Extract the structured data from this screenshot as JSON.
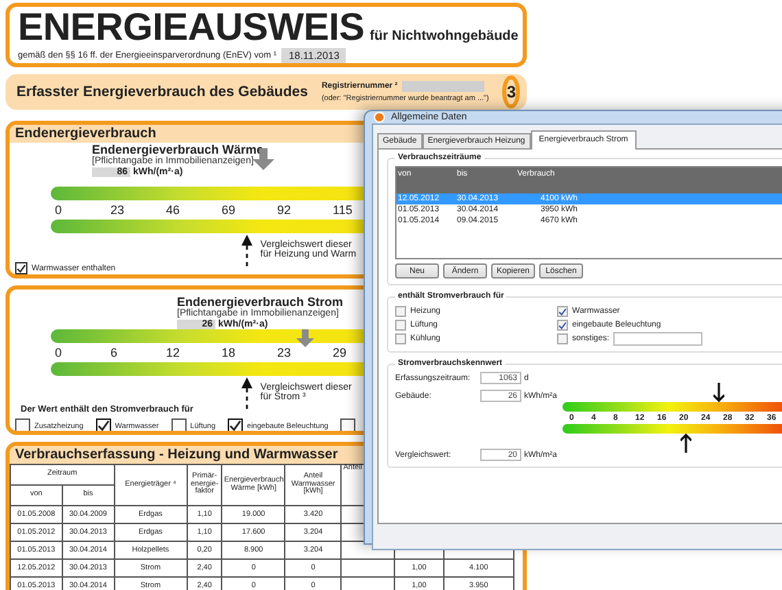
{
  "document": {
    "title": "ENERGIEAUSWEIS",
    "title_suffix": "für Nichtwohngebäude",
    "subtitle": "gemäß den §§ 16 ff. der Energieeinsparverordnung (EnEV) vom ¹",
    "date": "18.11.2013",
    "section_title": "Erfasster Energieverbrauch des Gebäudes",
    "registration_label": "Registriernummer ²",
    "registration_note": "(oder: \"Registriernummer wurde beantragt am ...\")",
    "page_badge": "3",
    "energy_heading": "Endenergieverbrauch",
    "scales": [
      {
        "title": "Endenergieverbrauch Wärme",
        "subtitle": "[Pflichtangabe in Immobilienanzeigen]",
        "value": "86",
        "unit": "kWh/(m²·a)",
        "ticks": [
          "0",
          "23",
          "46",
          "69",
          "92",
          "115"
        ],
        "value_marker": {
          "level": 0.455
        },
        "compare_marker": {
          "level": 0.42
        },
        "compare_lines": [
          "Vergleichswert dieser",
          "für Heizung und Warm"
        ]
      },
      {
        "title": "Endenergieverbrauch Strom",
        "subtitle": "[Pflichtangabe in Immobilienanzeigen]",
        "value": "26",
        "unit": "kWh/(m²·a)",
        "ticks": [
          "0",
          "6",
          "12",
          "18",
          "23",
          "29"
        ],
        "value_marker": {
          "level": 0.55
        },
        "compare_marker": {
          "level": 0.42
        },
        "compare_lines": [
          "Vergleichswert dieser",
          "für Strom ³"
        ]
      }
    ],
    "hot_water_check": {
      "label": "Warmwasser enthalten",
      "checked": true
    },
    "power_note": "Der Wert enthält den Stromverbrauch für",
    "power_checks": [
      {
        "label": "Zusatzheizung",
        "checked": false
      },
      {
        "label": "Warmwasser",
        "checked": true
      },
      {
        "label": "Lüftung",
        "checked": false
      },
      {
        "label": "eingebaute Beleuchtung",
        "checked": true
      },
      {
        "checked": false
      }
    ],
    "table": {
      "title": "Verbrauchserfassung - Heizung und Warmwasser",
      "period_heading": "Zeitraum",
      "columns": [
        "von",
        "bis",
        "Energieträger ⁴",
        "Primär-energie-faktor",
        "Energieverbrauch Wärme [kWh]",
        "Anteil Warmwasser [kWh]",
        "Anteil"
      ],
      "rows": [
        {
          "von": "01.05.2008",
          "bis": "30.04.2009",
          "carrier": "Erdgas",
          "factor": "1,10",
          "heat": "19.000",
          "hot_water": "3.420"
        },
        {
          "von": "01.05.2012",
          "bis": "30.04.2013",
          "carrier": "Erdgas",
          "factor": "1,10",
          "heat": "17.600",
          "hot_water": "3.204"
        },
        {
          "von": "01.05.2013",
          "bis": "30.04.2014",
          "carrier": "Holzpellets",
          "factor": "0,20",
          "heat": "8.900",
          "hot_water": "3.204"
        },
        {
          "von": "12.05.2012",
          "bis": "30.04.2013",
          "carrier": "Strom",
          "factor": "2,40",
          "heat": "0",
          "hot_water": "0",
          "column_8": "1,00",
          "column_9": "4.100"
        },
        {
          "von": "01.05.2013",
          "bis": "30.04.2014",
          "carrier": "Strom",
          "factor": "2,40",
          "heat": "0",
          "hot_water": "0",
          "column_8": "1,00",
          "column_9": "3.950"
        }
      ]
    }
  },
  "dialog": {
    "title": "Allgemeine Daten",
    "tabs": [
      {
        "label": "Gebäude",
        "selected": false
      },
      {
        "label": "Energieverbrauch Heizung",
        "selected": false
      },
      {
        "label": "Energieverbrauch Strom",
        "selected": true
      }
    ],
    "periods_group": "Verbrauchszeiträume",
    "list_columns": [
      "von",
      "bis",
      "Verbrauch"
    ],
    "periods": [
      {
        "von": "12.05.2012",
        "bis": "30.04.2013",
        "usage": "4100 kWh",
        "selected": true
      },
      {
        "von": "01.05.2013",
        "bis": "30.04.2014",
        "usage": "3950 kWh",
        "selected": false
      },
      {
        "von": "01.05.2014",
        "bis": "09.04.2015",
        "usage": "4670 kWh",
        "selected": false
      }
    ],
    "buttons": [
      "Neu",
      "Ändern",
      "Kopieren",
      "Löschen"
    ],
    "usage_group": "enthält Stromverbrauch für",
    "usage_checks": [
      {
        "label": "Heizung",
        "checked": false
      },
      {
        "label": "Lüftung",
        "checked": false
      },
      {
        "label": "Kühlung",
        "checked": false
      },
      {
        "label": "Warmwasser",
        "checked": true
      },
      {
        "label": "eingebaute Beleuchtung",
        "checked": true
      },
      {
        "label": "sonstiges:",
        "checked": false,
        "kind": "with_field"
      }
    ],
    "index_group": "Stromverbrauchskennwert",
    "fields": [
      {
        "label": "Erfassungszeitraum:",
        "value": "1063",
        "unit": "d"
      },
      {
        "label": "Gebäude:",
        "value": "26",
        "unit": "kWh/m²a"
      },
      {
        "label": "Vergleichswert:",
        "value": "20",
        "unit": "kWh/m²a"
      }
    ],
    "scale": {
      "ticks": [
        "0",
        "4",
        "8",
        "12",
        "16",
        "20",
        "24",
        "28",
        "32",
        "36"
      ],
      "value_marker": {
        "level": 0.62
      },
      "compare_marker": {
        "level": 0.49
      }
    }
  }
}
